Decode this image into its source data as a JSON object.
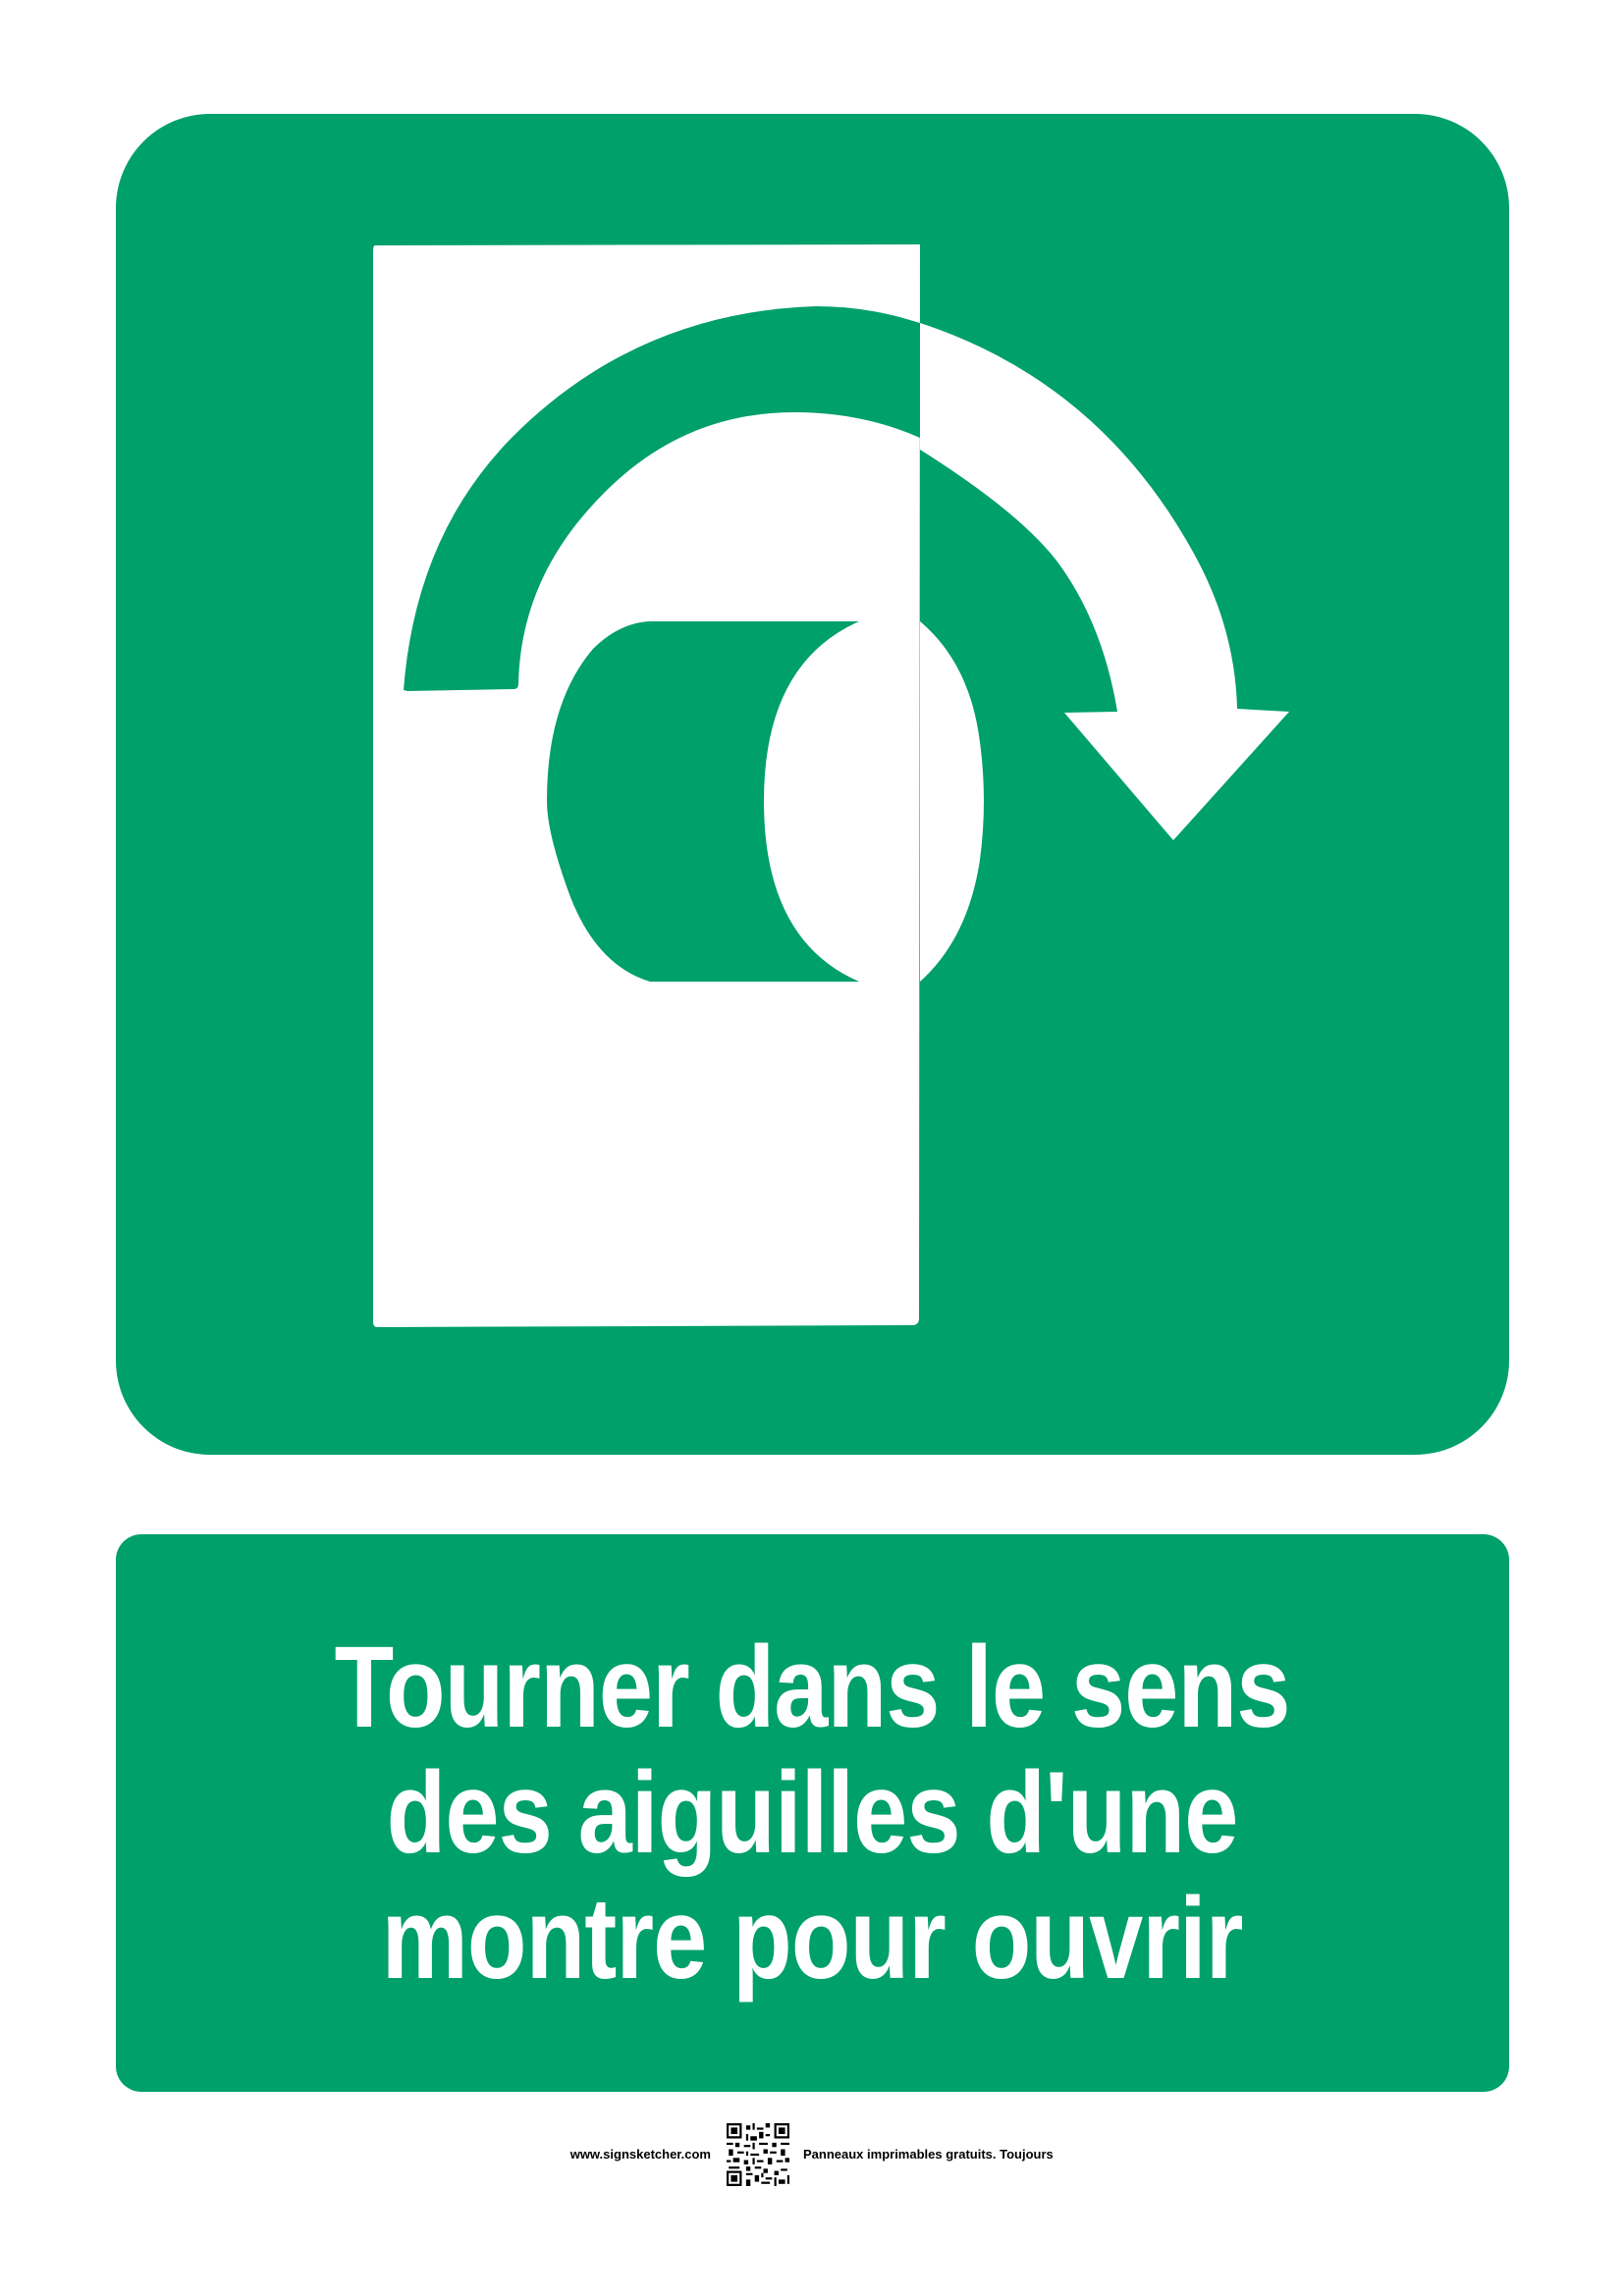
{
  "sign": {
    "pictogram_icon": "turn-clockwise-to-open-icon",
    "caption_lines": [
      "Tourner dans le sens",
      "des aiguilles d'une",
      "montre pour ouvrir"
    ]
  },
  "footer": {
    "url": "www.signsketcher.com",
    "qr_icon": "qr-code-icon",
    "tagline": "Panneaux imprimables gratuits. Toujours"
  },
  "colors": {
    "sign_green": "#00a06a",
    "foreground": "#ffffff",
    "footer_text": "#000000"
  }
}
